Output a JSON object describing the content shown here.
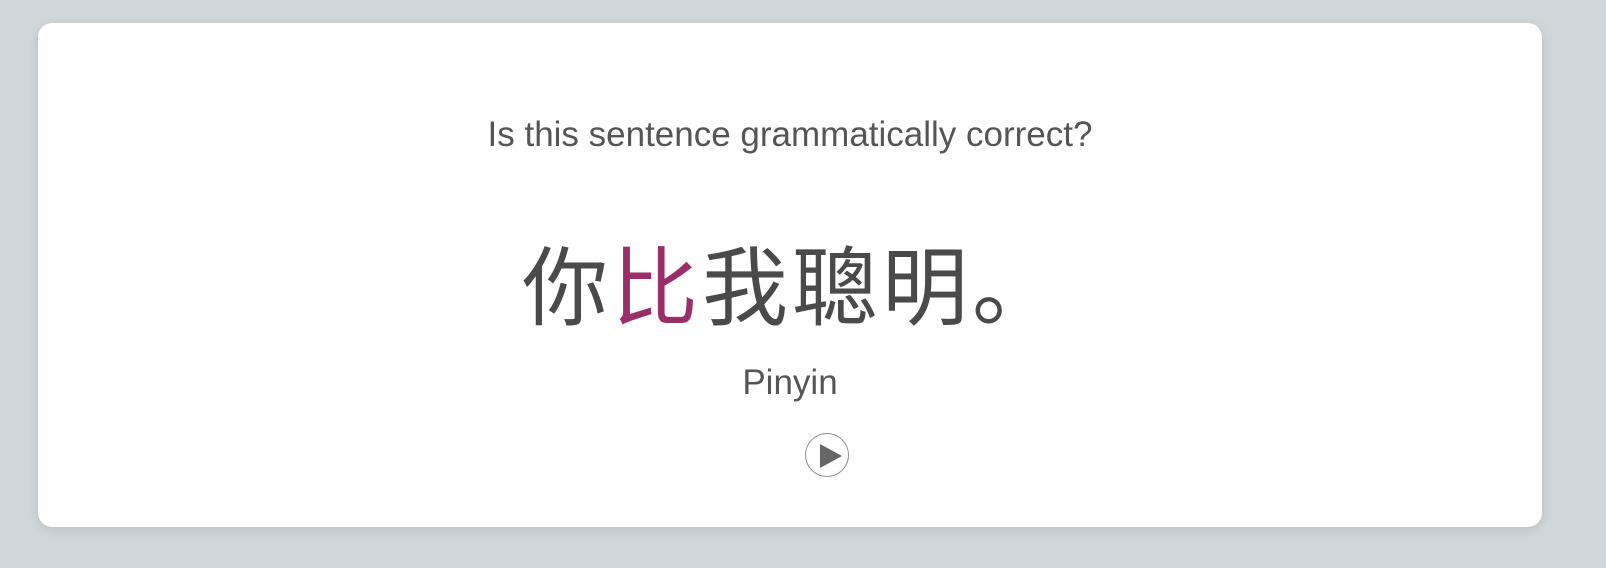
{
  "prompt": {
    "question": "Is this sentence grammatically correct?"
  },
  "sentence": {
    "chars": [
      "你",
      "比",
      "我",
      "聰",
      "明",
      "。"
    ],
    "highlight_index": 1
  },
  "pinyin_label": "Pinyin",
  "audio": {
    "icon": "play-icon"
  },
  "colors": {
    "background": "#cfd7da",
    "card": "#ffffff",
    "text": "#4a4a4a",
    "highlight": "#9b2d6b"
  }
}
